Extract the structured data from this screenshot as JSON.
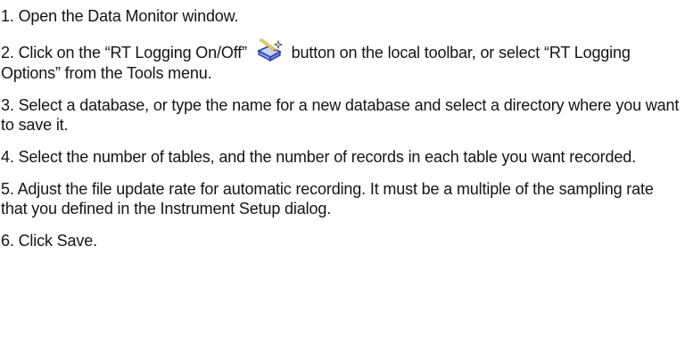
{
  "steps": [
    {
      "number": "1.",
      "text": "Open the Data Monitor window."
    },
    {
      "number": "2.",
      "text_before": "Click on the “RT Logging On/Off”",
      "icon": "rt-logging-toggle-icon",
      "text_after": "button on the local toolbar, or select “RT Logging Options” from the Tools menu."
    },
    {
      "number": "3.",
      "text": "Select a database, or type the name for a new database and select a directory where you want to save it."
    },
    {
      "number": "4.",
      "text": "Select the number of tables, and the number of records in each table you want recorded."
    },
    {
      "number": "5.",
      "text": "Adjust the file update rate for automatic recording. It must be a multiple of the sampling rate that you defined in the Instrument Setup dialog."
    },
    {
      "number": "6.",
      "text": "Click Save."
    }
  ]
}
